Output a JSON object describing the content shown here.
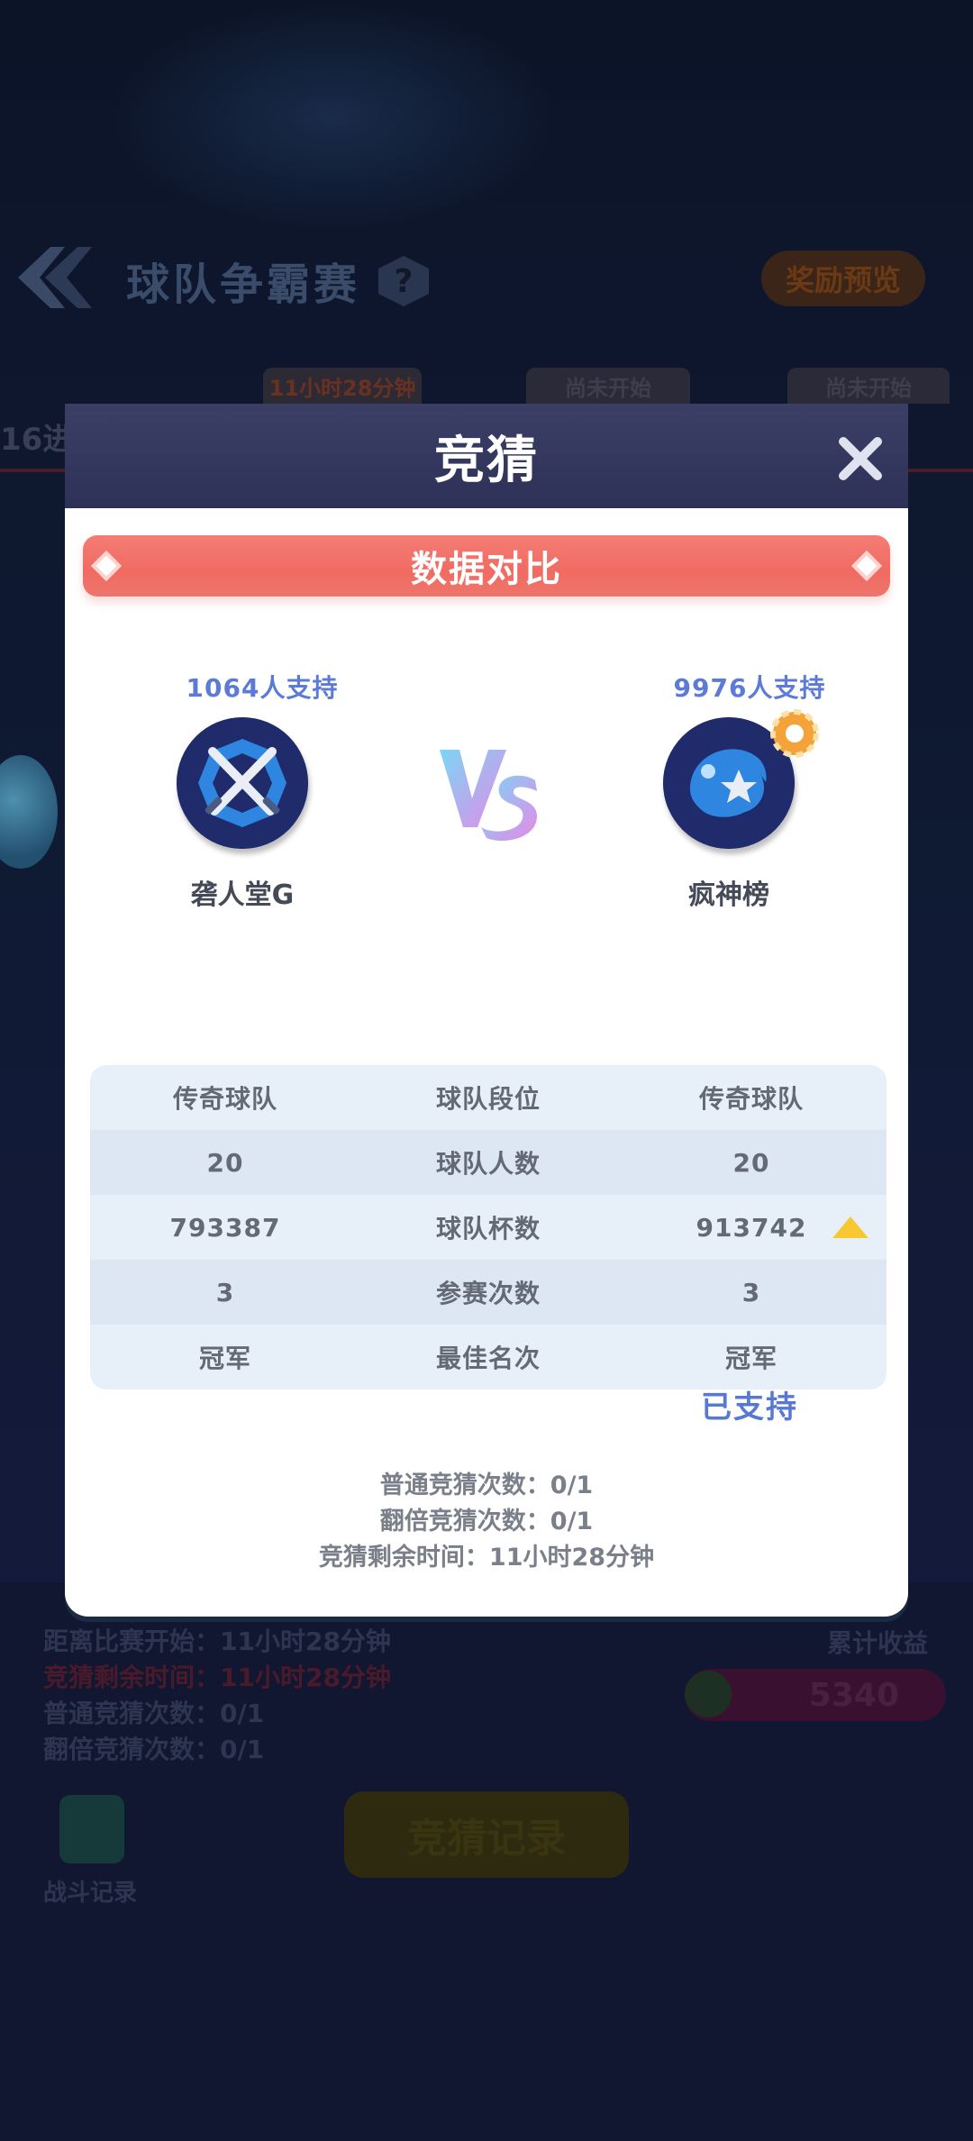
{
  "background": {
    "title": "球队争霸赛",
    "help_icon": "?",
    "reward_preview": "奖励预览",
    "stage_tabs": [
      "11小时28分钟",
      "尚未开始",
      "尚未开始"
    ],
    "round_label": "16进",
    "info_lines": [
      "距离比赛开始：11小时28分钟",
      "竞猜剩余时间：11小时28分钟",
      "普通竞猜次数：0/1",
      "翻倍竞猜次数：0/1"
    ],
    "earnings_label": "累计收益",
    "earnings_value": "5340",
    "record_button": "竞猜记录",
    "battle_record_label": "战斗记录"
  },
  "modal": {
    "title": "竞猜",
    "banner_title": "数据对比",
    "left_team": {
      "supporters": "1064人支持",
      "name": "砻人堂G"
    },
    "right_team": {
      "supporters": "9976人支持",
      "name": "疯神榜"
    },
    "vs_text": "VS",
    "stats": [
      {
        "left": "传奇球队",
        "label": "球队段位",
        "right": "传奇球队"
      },
      {
        "left": "20",
        "label": "球队人数",
        "right": "20"
      },
      {
        "left": "793387",
        "label": "球队杯数",
        "right": "913742"
      },
      {
        "left": "3",
        "label": "参赛次数",
        "right": "3"
      },
      {
        "left": "冠军",
        "label": "最佳名次",
        "right": "冠军"
      }
    ],
    "supported_label": "已支持",
    "normal_guess": "普通竞猜次数：0/1",
    "double_guess": "翻倍竞猜次数：0/1",
    "remaining_time": "竞猜剩余时间：11小时28分钟"
  },
  "colors": {
    "header": "#2e3157",
    "banner": "#f06b62",
    "accent_blue": "#5c7bd8",
    "table_light": "#e7f0f9",
    "table_dark": "#dde6f3",
    "arrow_yellow": "#f7c82f"
  },
  "icons": [
    "back-arrow-icon",
    "help-icon",
    "close-icon",
    "crossed-swords-icon",
    "star-wave-icon",
    "gear-badge-icon",
    "up-arrow-icon",
    "coin-icon",
    "battle-record-icon"
  ]
}
